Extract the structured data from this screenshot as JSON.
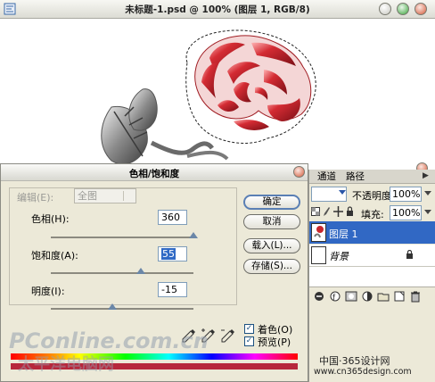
{
  "document": {
    "title": "未标题-1.psd @ 100% (图层 1, RGB/8)"
  },
  "dialog": {
    "title": "色相/饱和度",
    "edit": {
      "label": "编辑(E):",
      "value": "全图"
    },
    "hue": {
      "label": "色相(H):",
      "value": "360",
      "level": 1.0
    },
    "saturation": {
      "label": "饱和度(A):",
      "value": "55",
      "level": 0.63
    },
    "lightness": {
      "label": "明度(I):",
      "value": "-15",
      "level": 0.43
    },
    "buttons": {
      "ok": "确定",
      "cancel": "取消",
      "load": "载入(L)...",
      "save": "存储(S)..."
    },
    "colorize": {
      "label": "着色(O)",
      "checked": true
    },
    "preview": {
      "label": "预览(P)",
      "checked": true
    }
  },
  "layers_panel": {
    "tabs": [
      "通道",
      "路径"
    ],
    "opacity_label": "不透明度:",
    "opacity_value": "100%",
    "fill_label": "填充:",
    "fill_value": "100%",
    "layers": [
      {
        "name": "图层 1",
        "selected": true
      },
      {
        "name": "背景",
        "locked": true
      }
    ]
  },
  "watermarks": {
    "pconline": "PConline.com.cn",
    "pconline_sub": "太平洋电脑网",
    "site_name": "中国·365设计网",
    "site_url": "www.cn365design.com"
  },
  "colors": {
    "rose_red": "#c8262c",
    "selection_blue": "#3168c4",
    "dialog_bg": "#ece9d8",
    "ramp_bottom": "#b7273c"
  }
}
